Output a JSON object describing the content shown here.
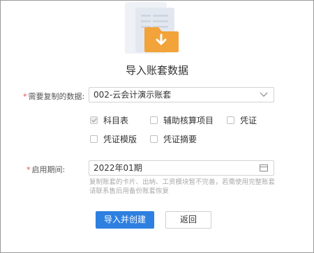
{
  "dialog": {
    "title": "导入账套数据",
    "copy_field": {
      "label": "需要复制的数据:",
      "value": "002-云会计演示账套"
    },
    "options": [
      {
        "label": "科目表",
        "checked": true,
        "disabled": true
      },
      {
        "label": "辅助核算项目",
        "checked": false
      },
      {
        "label": "凭证",
        "checked": false
      },
      {
        "label": "凭证模版",
        "checked": false
      },
      {
        "label": "凭证摘要",
        "checked": false
      }
    ],
    "period_field": {
      "label": "启用期间:",
      "value": "2022年01期"
    },
    "hint": "复制账套的卡片、出纳、工资模块暂不完善，若需使用完整账套请联系售后用备份账套恢复",
    "buttons": {
      "confirm": "导入并创建",
      "back": "返回"
    }
  },
  "colors": {
    "primary": "#2d7fe0",
    "illustration_orange": "#f2a33a",
    "required_star": "#e84b4b"
  },
  "icons": [
    "document-folder-download-icon",
    "chevron-down-icon",
    "calendar-icon"
  ]
}
